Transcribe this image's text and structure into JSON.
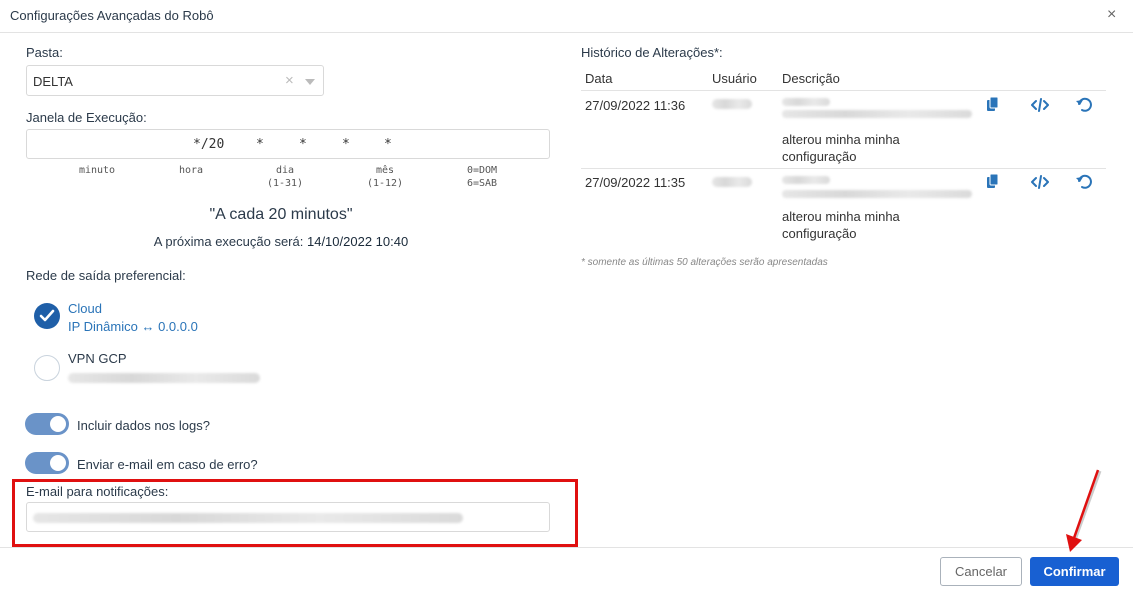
{
  "dialog": {
    "title": "Configurações Avançadas do Robô",
    "close_symbol": "×"
  },
  "pasta": {
    "label": "Pasta:",
    "value": "DELTA"
  },
  "janela": {
    "label": "Janela de Execução:",
    "cron_values": [
      "*/20",
      "*",
      "*",
      "*",
      "*"
    ],
    "fields": [
      "minuto",
      "hora",
      "dia\n(1-31)",
      "mês\n(1-12)",
      "0=DOM\n6=SAB"
    ],
    "summary": "\"A cada 20 minutos\"",
    "next_prefix": "A próxima execução será:",
    "next_value": "14/10/2022 10:40"
  },
  "rede": {
    "label": "Rede de saída preferencial:",
    "options": [
      {
        "title": "Cloud",
        "subtitle": "IP Dinâmico ↔ 0.0.0.0",
        "selected": true
      },
      {
        "title": "VPN GCP",
        "subtitle": "",
        "selected": false
      }
    ]
  },
  "toggles": [
    {
      "label": "Incluir dados nos logs?",
      "on": true
    },
    {
      "label": "Enviar e-mail em caso de erro?",
      "on": true
    }
  ],
  "email": {
    "label": "E-mail para notificações:"
  },
  "historico": {
    "title": "Histórico de Alterações*:",
    "headers": [
      "Data",
      "Usuário",
      "Descrição"
    ],
    "rows": [
      {
        "date": "27/09/2022 11:36",
        "desc_line1": "alterou minha minha",
        "desc_line2": "configuração"
      },
      {
        "date": "27/09/2022 11:35",
        "desc_line1": "alterou minha minha",
        "desc_line2": "configuração"
      }
    ],
    "footnote": "* somente as últimas 50 alterações serão apresentadas"
  },
  "footer": {
    "cancel": "Cancelar",
    "confirm": "Confirmar"
  },
  "colors": {
    "primary": "#1860d2",
    "highlight": "#e01010",
    "toggle": "#6a93c8",
    "radio": "#1f5fa8"
  }
}
